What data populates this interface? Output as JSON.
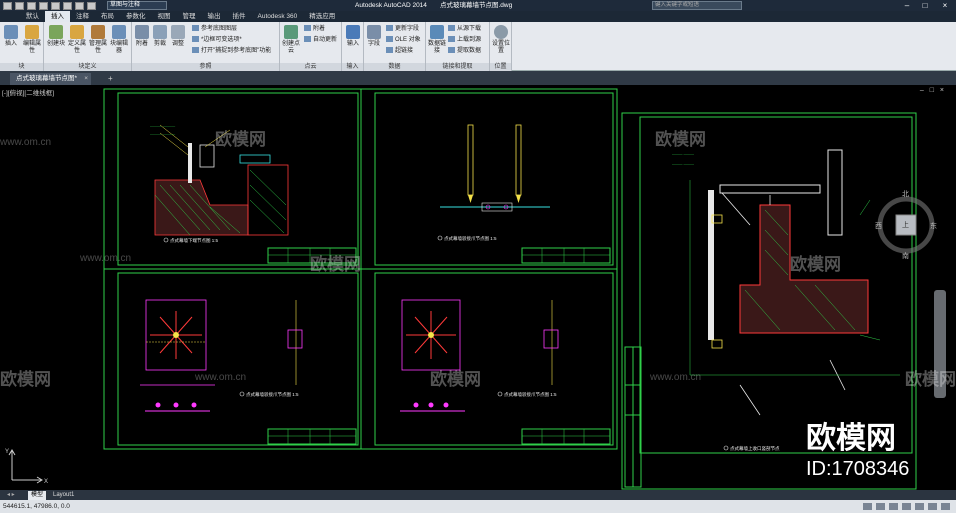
{
  "titlebar": {
    "workspace": "草图与注释",
    "app_name": "Autodesk AutoCAD 2014",
    "document_name": "点式玻璃幕墙节点图.dwg",
    "search_placeholder": "键入关键字或短语"
  },
  "menu_tabs": [
    "默认",
    "插入",
    "注释",
    "布局",
    "参数化",
    "视图",
    "管理",
    "输出",
    "插件",
    "Autodesk 360",
    "精选应用"
  ],
  "active_tab": "插入",
  "ribbon": {
    "panels": [
      {
        "title": "块",
        "buttons": [
          "插入",
          "编辑属性"
        ]
      },
      {
        "title": "块定义",
        "buttons": [
          "创建块",
          "定义属性",
          "管理属性",
          "块编辑器"
        ]
      },
      {
        "title": "参照",
        "buttons": [
          "附着",
          "剪裁",
          "调整"
        ],
        "small": [
          "参考底图图层",
          "*边框可变选项*",
          "打开\"捕捉到参考底图\"功能"
        ]
      },
      {
        "title": "点云",
        "buttons": [
          "创建点云"
        ],
        "small": [
          "附着",
          "自动更新"
        ]
      },
      {
        "title": "输入",
        "buttons": [
          "输入"
        ]
      },
      {
        "title": "数据",
        "buttons": [
          "字段"
        ],
        "small": [
          "更新字段",
          "OLE 对象",
          "超链接"
        ]
      },
      {
        "title": "链接和提取",
        "buttons": [
          "数据链接"
        ],
        "small": [
          "从源下载",
          "上载到源",
          "提取数据"
        ]
      },
      {
        "title": "位置",
        "buttons": [
          "设置位置"
        ]
      }
    ]
  },
  "file_tab": "点式玻璃幕墙节点图*",
  "viewport_label": "[-][俯视][二维线框]",
  "compass": {
    "north": "北",
    "south": "南",
    "east": "东",
    "west": "西",
    "center": "上"
  },
  "drawing_titles": [
    "点式幕墙下端节点图 1:5",
    "点式幕墙驳接爪节点图 1:5",
    "点式幕墙驳接爪节点图 1:5",
    "点式幕墙驳接爪节点图 1:5",
    "点式幕墙上收口竖剖节点"
  ],
  "watermark": {
    "brand": "欧模网",
    "url": "www.om.cn",
    "id_text": "ID:1708346"
  },
  "layout_tabs": [
    "模型",
    "Layout1"
  ],
  "active_layout": "模型",
  "status": {
    "coords": "544615.1, 47986.0, 0.0"
  },
  "colors": {
    "green": "#2fd14a",
    "magenta": "#ff3aff",
    "yellow": "#f5e24a",
    "red": "#ff3a3a",
    "cyan": "#38e0e0",
    "white": "#e8e8e8"
  }
}
